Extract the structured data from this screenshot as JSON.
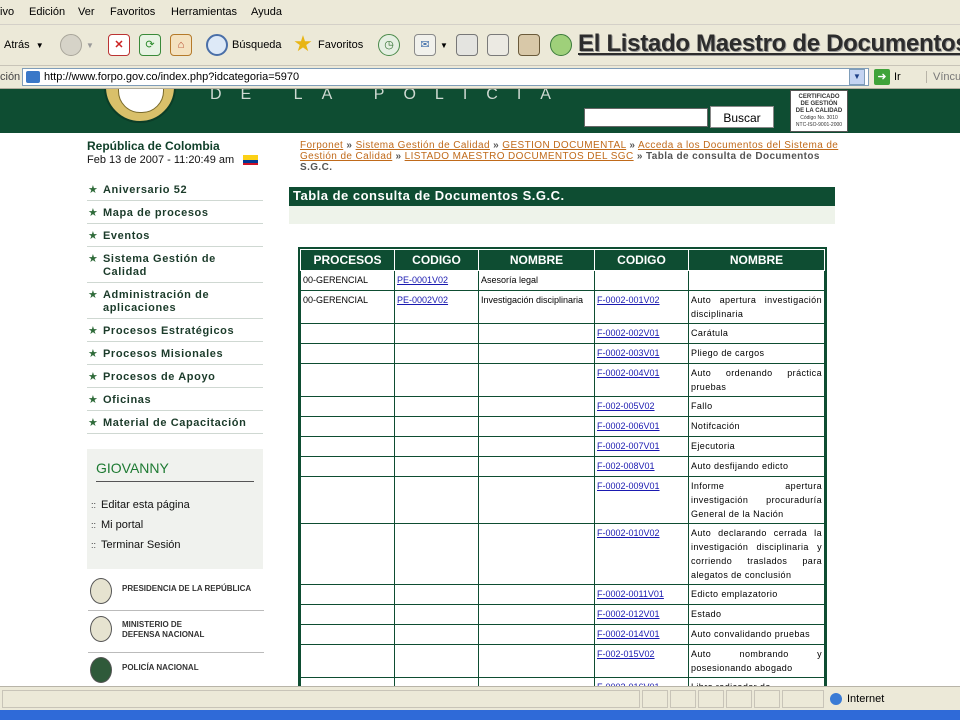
{
  "menu": [
    "ivo",
    "Edición",
    "Ver",
    "Favoritos",
    "Herramientas",
    "Ayuda"
  ],
  "toolbar": {
    "back_label": "Atrás",
    "search_label": "Búsqueda",
    "favorites_label": "Favoritos",
    "headline": "El Listado Maestro de Documentos"
  },
  "address": {
    "label": "ción",
    "url": "http://www.forpo.gov.co/index.php?idcategoria=5970",
    "go_label": "Ir",
    "links_label": "Víncul"
  },
  "site": {
    "banner_text": "DE LA POLICIA",
    "search_button": "Buscar",
    "cert_lines": [
      "CERTIFICADO",
      "DE GESTIÓN",
      "DE LA CALIDAD"
    ],
    "cert_sub": "Código No. 3010",
    "cert_sub2": "NTC-ISO-9001-2000"
  },
  "sidebar": {
    "country": "República de Colombia",
    "datetime": "Feb 13 de 2007 - 11:20:49 am",
    "flag_colors": [
      "#fcd116",
      "#003893",
      "#ce1126"
    ],
    "items": [
      "Aniversario 52",
      "Mapa de procesos",
      "Eventos",
      "Sistema Gestión de Calidad",
      "Administración de aplicaciones",
      "Procesos Estratégicos",
      "Procesos Misionales",
      "Procesos de Apoyo",
      "Oficinas",
      "Material de Capacitación"
    ],
    "user": {
      "name": "GIOVANNY",
      "links": [
        "Editar esta página",
        "Mi portal",
        "Terminar Sesión"
      ]
    },
    "institutions": [
      "PRESIDENCIA DE LA REPÚBLICA",
      "MINISTERIO DE DEFENSA NACIONAL",
      "POLICÍA NACIONAL"
    ]
  },
  "breadcrumb": {
    "links": [
      "Forponet",
      "Sistema Gestión de Calidad",
      "GESTION DOCUMENTAL",
      "Acceda a los Documentos del Sistema de Gestión de Calidad",
      "LISTADO MAESTRO DOCUMENTOS DEL SGC"
    ],
    "current": "Tabla de consulta de Documentos S.G.C."
  },
  "page_title": "Tabla de consulta de Documentos S.G.C.",
  "table": {
    "headers": [
      "PROCESOS",
      "CODIGO",
      "NOMBRE",
      "CODIGO",
      "NOMBRE"
    ],
    "rows": [
      [
        "00-GERENCIAL",
        "PE-0001V02",
        "Asesoría legal",
        "",
        ""
      ],
      [
        "00-GERENCIAL",
        "PE-0002V02",
        "Investigación disciplinaria",
        "F-0002-001V02",
        "Auto apertura investigación disciplinaria"
      ],
      [
        "",
        "",
        "",
        "F-0002-002V01",
        "Carátula"
      ],
      [
        "",
        "",
        "",
        "F-0002-003V01",
        "Pliego de cargos"
      ],
      [
        "",
        "",
        "",
        "F-0002-004V01",
        "Auto ordenando práctica pruebas"
      ],
      [
        "",
        "",
        "",
        "F-002-005V02",
        "Fallo"
      ],
      [
        "",
        "",
        "",
        "F-0002-006V01",
        "Notifcación"
      ],
      [
        "",
        "",
        "",
        "F-0002-007V01",
        "Ejecutoria"
      ],
      [
        "",
        "",
        "",
        "F-002-008V01",
        "Auto desfijando edicto"
      ],
      [
        "",
        "",
        "",
        "F-0002-009V01",
        "Informe apertura investigación procuraduría General de la Nación"
      ],
      [
        "",
        "",
        "",
        "F-0002-010V02",
        "Auto declarando cerrada la investigación disciplinaria y corriendo traslados para alegatos de conclusión"
      ],
      [
        "",
        "",
        "",
        "F-0002-0011V01",
        "Edicto emplazatorio"
      ],
      [
        "",
        "",
        "",
        "F-0002-012V01",
        "Estado"
      ],
      [
        "",
        "",
        "",
        "F-0002-014V01",
        "Auto convalidando pruebas"
      ],
      [
        "",
        "",
        "",
        "F-002-015V02",
        "Auto nombrando y posesionando abogado"
      ],
      [
        "",
        "",
        "",
        "F-0002-016V01",
        "Libro radicador de"
      ]
    ]
  },
  "status": {
    "zone": "Internet"
  }
}
